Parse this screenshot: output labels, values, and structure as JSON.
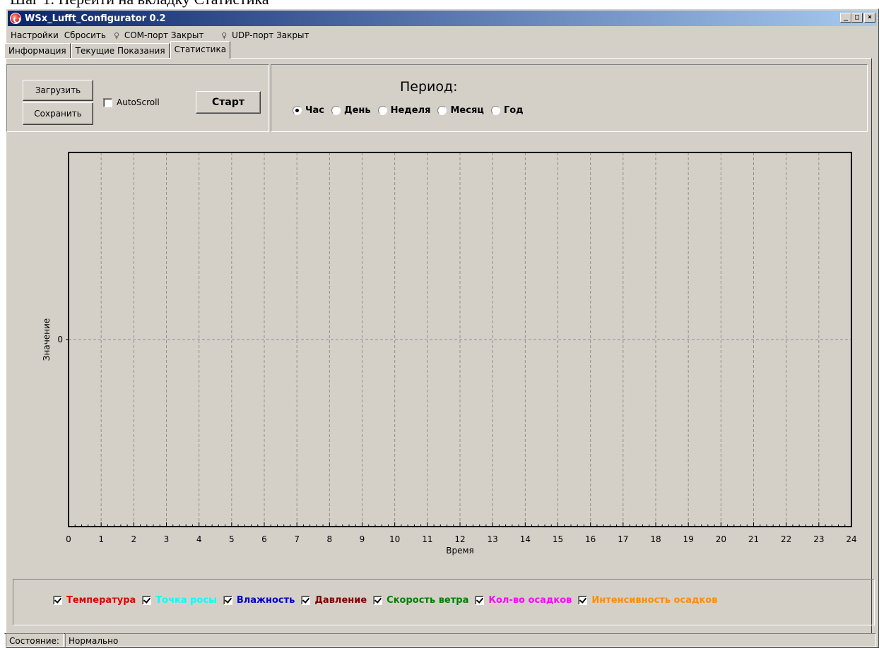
{
  "caption": "Шаг 1. Перейти на вкладку Статистика",
  "window": {
    "title": "WSx_Lufft_Configurator 0.2",
    "buttons": {
      "minimize": "_",
      "maximize": "□",
      "close": "×"
    }
  },
  "menu": {
    "settings": "Настройки",
    "reset": "Сбросить",
    "com_port": "COM-порт Закрыт",
    "udp_port": "UDP-порт Закрыт"
  },
  "tabs": [
    {
      "label": "Информация"
    },
    {
      "label": "Текущие Показания"
    },
    {
      "label": "Статистика",
      "active": true
    }
  ],
  "toolbar": {
    "load": "Загрузить",
    "save": "Сохранить",
    "autoscroll": "AutoScroll",
    "autoscroll_checked": false,
    "start": "Старт"
  },
  "period": {
    "title": "Период:",
    "options": [
      "Час",
      "День",
      "Неделя",
      "Месяц",
      "Год"
    ],
    "selected": "Час"
  },
  "chart_data": {
    "type": "line",
    "xlabel": "Время",
    "ylabel": "Значение",
    "x_ticks": [
      0,
      1,
      2,
      3,
      4,
      5,
      6,
      7,
      8,
      9,
      10,
      11,
      12,
      13,
      14,
      15,
      16,
      17,
      18,
      19,
      20,
      21,
      22,
      23,
      24
    ],
    "y_ticks": [
      0
    ],
    "xlim": [
      0,
      24
    ],
    "grid": true,
    "series": []
  },
  "legend": [
    {
      "label": "Температура",
      "color": "#e00000",
      "checked": true
    },
    {
      "label": "Точка росы",
      "color": "#00ffff",
      "checked": true
    },
    {
      "label": "Влажность",
      "color": "#0000c8",
      "checked": true
    },
    {
      "label": "Давление",
      "color": "#800000",
      "checked": true
    },
    {
      "label": "Скорость ветра",
      "color": "#008000",
      "checked": true
    },
    {
      "label": "Кол-во осадков",
      "color": "#ff00ff",
      "checked": true
    },
    {
      "label": "Интенсивность осадков",
      "color": "#ff8c00",
      "checked": true
    }
  ],
  "status": {
    "label": "Состояние:",
    "value": "Нормально"
  }
}
